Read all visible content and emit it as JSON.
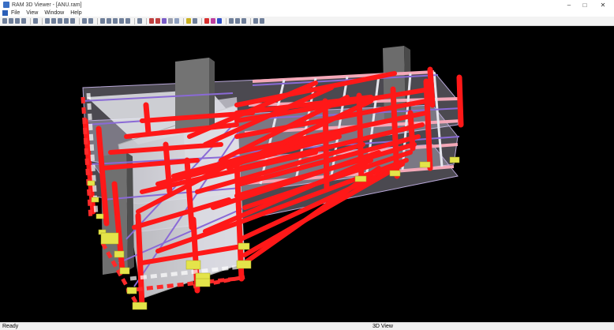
{
  "window": {
    "title": "RAM 3D Viewer - [ANU.ram]"
  },
  "menu": {
    "items": [
      "File",
      "View",
      "Window",
      "Help"
    ]
  },
  "toolbar": {
    "buttons": [
      "new",
      "open",
      "save",
      "print",
      "sep",
      "copy",
      "sep",
      "view-top",
      "view-front",
      "view-side",
      "view-iso",
      "view-3d",
      "sep",
      "home",
      "rotate",
      "sep",
      "zoom-window",
      "zoom-in",
      "zoom-out",
      "zoom-extents",
      "pan",
      "sep",
      "select",
      "sep",
      "beams",
      "columns",
      "braces",
      "walls",
      "slabs",
      "sep",
      "footings",
      "joists",
      "sep",
      "color-red",
      "color-magenta",
      "color-blue",
      "sep",
      "shade",
      "wire",
      "hidden",
      "sep",
      "transparent",
      "settings"
    ]
  },
  "status": {
    "left": "Ready",
    "right": "3D View"
  },
  "colors": {
    "viewport": "#000000",
    "member": "#ff1a1a",
    "brace": "#8a6ad6",
    "wall": "#e8e8ee",
    "footing": "#e8e84a",
    "core": "#6f6f6f"
  }
}
